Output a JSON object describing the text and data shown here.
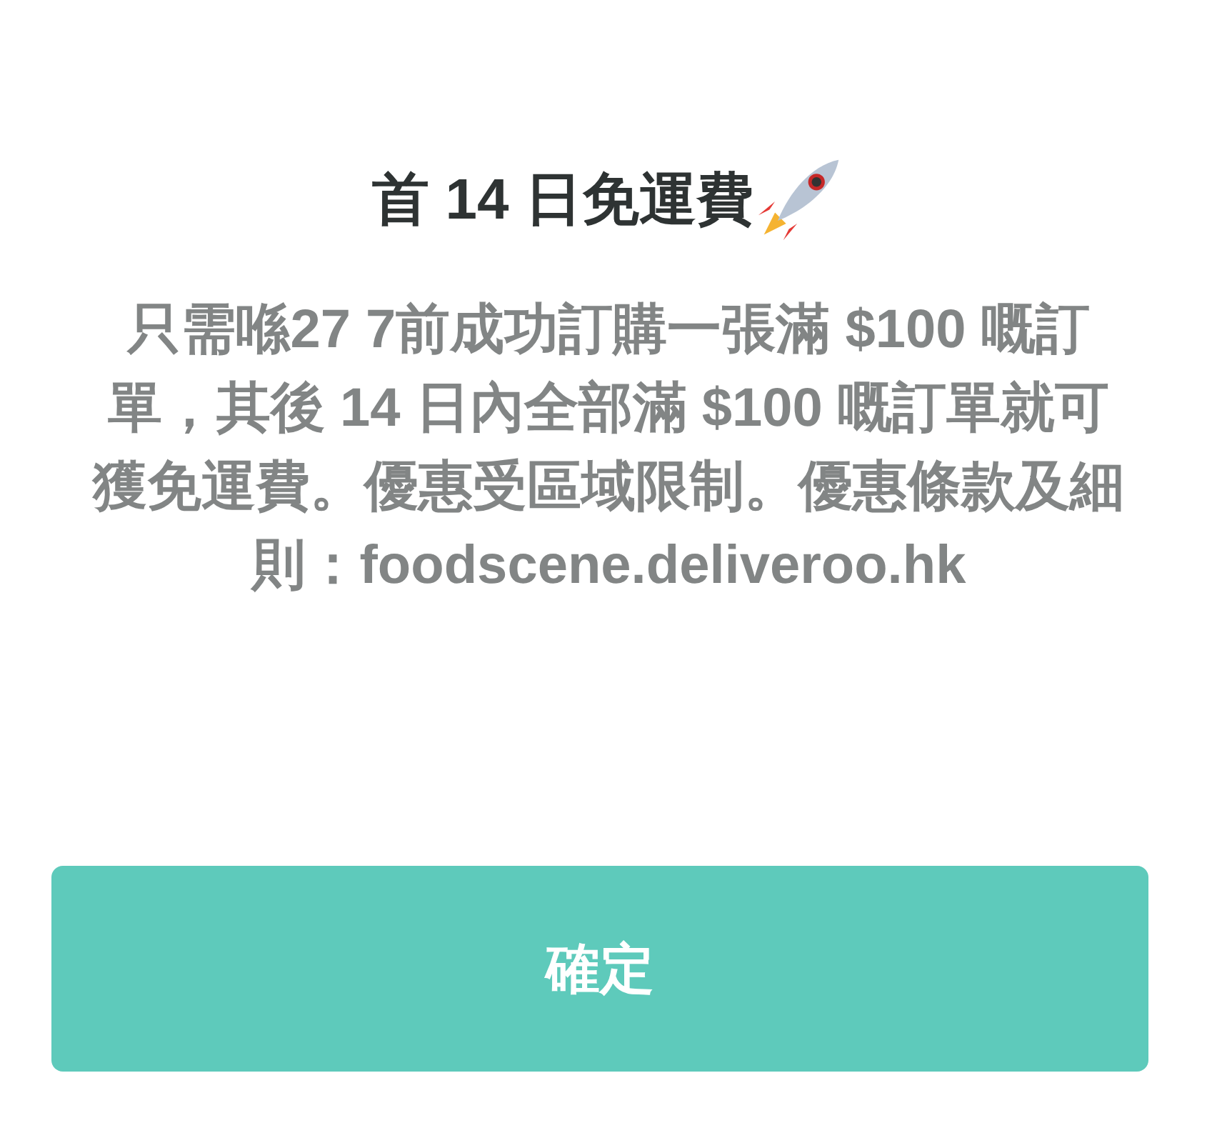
{
  "dialog": {
    "title": "首 14 日免運費",
    "message": "只需喺27 7前成功訂購一張滿 $100 嘅訂單，其後 14 日內全部滿 $100 嘅訂單就可獲免運費。優惠受區域限制。優惠條款及細則：foodscene.deliveroo.hk",
    "buttons": [
      "確定"
    ]
  }
}
